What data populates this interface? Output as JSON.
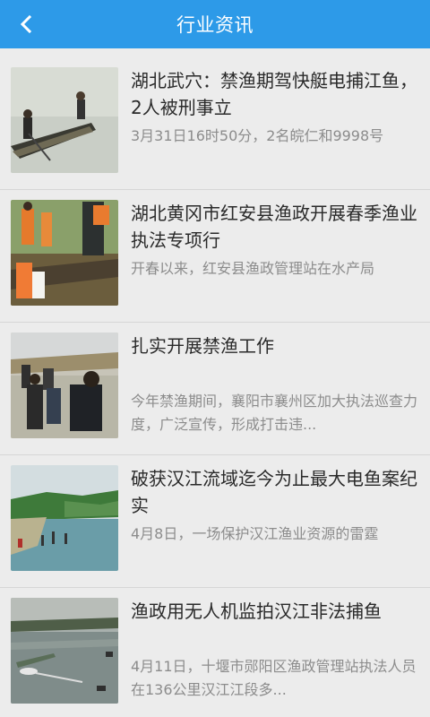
{
  "header": {
    "title": "行业资讯"
  },
  "news": [
    {
      "title": "湖北武穴：禁渔期驾快艇电捕江鱼，2人被刑事立",
      "summary": "3月31日16时50分，2名皖仁和9998号"
    },
    {
      "title": "湖北黄冈市红安县渔政开展春季渔业执法专项行",
      "summary": "开春以来，红安县渔政管理站在水产局"
    },
    {
      "title": "扎实开展禁渔工作",
      "summary": "今年禁渔期间，襄阳市襄州区加大执法巡查力度，广泛宣传，形成打击违..."
    },
    {
      "title": "破获汉江流域迄今为止最大电鱼案纪实",
      "summary": "4月8日，一场保护汉江渔业资源的雷霆"
    },
    {
      "title": "渔政用无人机监拍汉江非法捕鱼",
      "summary": "4月11日，十堰市郧阳区渔政管理站执法人员在136公里汉江江段多..."
    }
  ]
}
